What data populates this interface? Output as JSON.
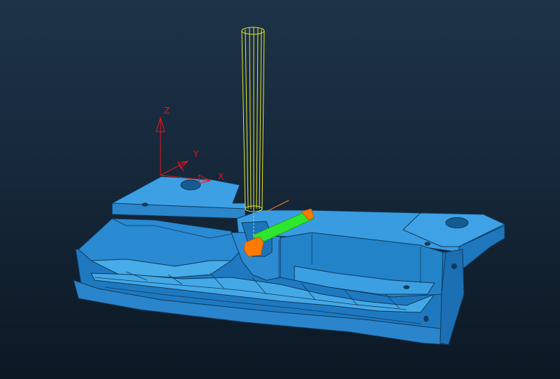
{
  "viewport": {
    "background_top": "#1e3348",
    "background_bottom": "#0c1824"
  },
  "triad": {
    "x_label": "X",
    "y_label": "Y",
    "z_label": "Z",
    "color": "#e8141c"
  },
  "part": {
    "name": "part-model",
    "color": "#2f8fd6",
    "edge_color": "#0d3a5c"
  },
  "tool": {
    "name": "end-mill-tool",
    "color": "#e6e628"
  },
  "toolpath": {
    "cut_color": "#2ee62e",
    "lead_color": "#ff7a00"
  }
}
